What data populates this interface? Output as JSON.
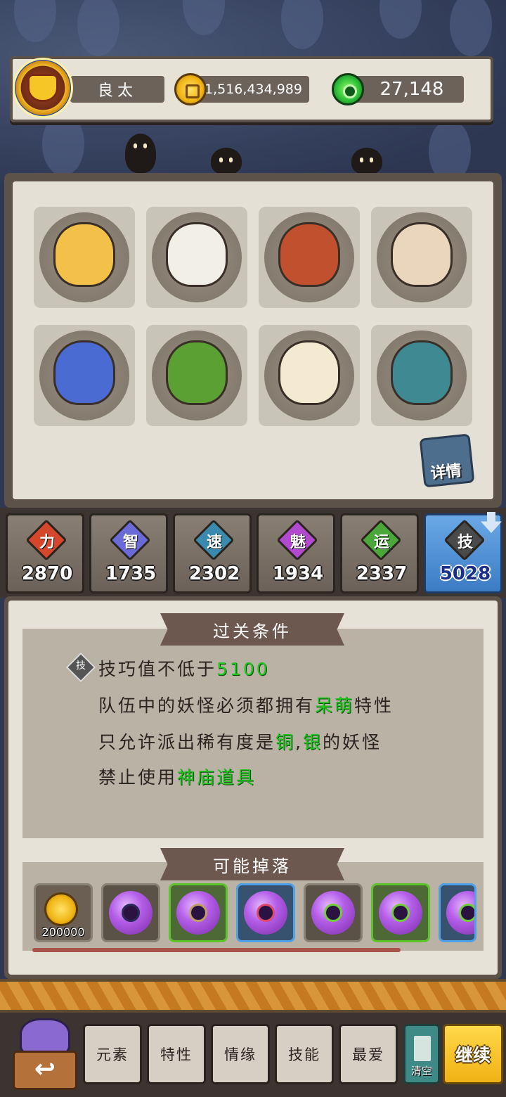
{
  "header": {
    "player_name": "良太",
    "coins": "1,516,434,989",
    "gems": "27,148"
  },
  "team": {
    "heroes": [
      {
        "color": "#f3c04a"
      },
      {
        "color": "#f1efe6"
      },
      {
        "color": "#c0502e"
      },
      {
        "color": "#e9d6bc"
      },
      {
        "color": "#4a6bd2"
      },
      {
        "color": "#5aa032"
      },
      {
        "color": "#f4ead2"
      },
      {
        "color": "#3f8a92"
      }
    ],
    "detail_label": "详情"
  },
  "stats": [
    {
      "symbol": "力",
      "value": "2870",
      "color": "#d5472a"
    },
    {
      "symbol": "智",
      "value": "1735",
      "color": "#6a6ad8"
    },
    {
      "symbol": "速",
      "value": "2302",
      "color": "#3a8ab0"
    },
    {
      "symbol": "魅",
      "value": "1934",
      "color": "#b24ad0"
    },
    {
      "symbol": "运",
      "value": "2337",
      "color": "#4aa83a"
    },
    {
      "symbol": "技",
      "value": "5028",
      "color": "#4a4a4a"
    }
  ],
  "conditions": {
    "title": "过关条件",
    "skill_badge": "技",
    "line1_pre": "技巧值不低于",
    "line1_hl": "5100",
    "line2_pre": "队伍中的妖怪必须都拥有",
    "line2_hl": "呆萌",
    "line2_post": "特性",
    "line3_pre": "只允许派出稀有度是",
    "line3_hl1": "铜",
    "line3_sep": ",",
    "line3_hl2": "银",
    "line3_post": "的妖怪",
    "line4_pre": "禁止使用",
    "line4_hl": "神庙道具"
  },
  "drops": {
    "title": "可能掉落",
    "coin_amount": "200000"
  },
  "bottom": {
    "tabs": [
      "元素",
      "特性",
      "情缘",
      "技能",
      "最爱"
    ],
    "clear_label": "清空",
    "continue_label": "继续"
  }
}
